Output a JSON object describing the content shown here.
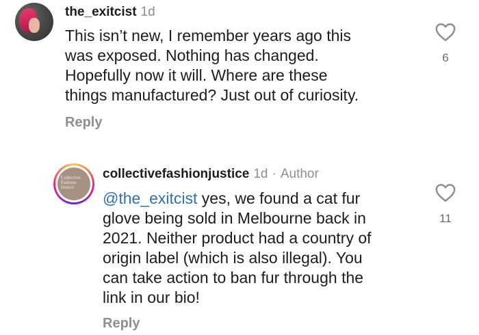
{
  "comments": [
    {
      "username": "the_exitcist",
      "time": "1d",
      "lines": [
        "This isn’t new, I remember years ago this",
        "was exposed. Nothing has changed.",
        "Hopefully now it will. Where are these",
        "things manufactured? Just out of curiosity."
      ],
      "likes": "6",
      "reply_label": "Reply",
      "avatar_icon": "user-avatar-photo"
    },
    {
      "username": "collectivefashionjustice",
      "time": "1d",
      "separator": "·",
      "badge": "Author",
      "mention": "@the_exitcist",
      "first_line_rest": " yes, we found a cat fur",
      "lines": [
        "glove being sold in Melbourne back in",
        "2021. Neither product had a country of",
        "origin label (which is also illegal). You",
        "can take action to ban fur through the",
        "link in our bio!"
      ],
      "likes": "11",
      "reply_label": "Reply",
      "avatar_logo_lines": [
        "Collective",
        "Fashion",
        "Justice"
      ],
      "avatar_ring_colors": [
        "#f9ce34",
        "#ee2a7b",
        "#6228d7"
      ]
    }
  ],
  "colors": {
    "text": "#1c1c1c",
    "muted": "#8e8e8e",
    "mention": "#2f6fb7"
  }
}
